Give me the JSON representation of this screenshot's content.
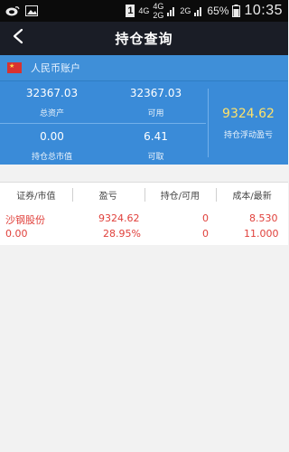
{
  "status_bar": {
    "left_icons": [
      "weibo-icon",
      "gallery-icon"
    ],
    "sim_badge": "1",
    "net1": "4G",
    "net2_top": "4G",
    "net2_bottom": "2G",
    "net3": "2G",
    "battery_percent": "65%",
    "time": "10:35"
  },
  "header": {
    "title": "持仓查询",
    "back_icon": "chevron-left-icon"
  },
  "account": {
    "flag_icon": "cn-flag-icon",
    "name": "人民币账户",
    "total_assets_value": "32367.03",
    "total_assets_label": "总资产",
    "available_value": "32367.03",
    "available_label": "可用",
    "market_value": "0.00",
    "market_value_label": "持仓总市值",
    "withdrawable_value": "6.41",
    "withdrawable_label": "可取",
    "floating_pl_value": "9324.62",
    "floating_pl_label": "持仓浮动盈亏"
  },
  "table": {
    "columns": [
      "证券/市值",
      "盈亏",
      "持仓/可用",
      "成本/最新"
    ],
    "rows": [
      {
        "name": "沙钢股份",
        "market_value": "0.00",
        "pl": "9324.62",
        "pl_pct": "28.95%",
        "position": "0",
        "available": "0",
        "cost": "8.530",
        "latest": "11.000"
      }
    ]
  },
  "colors": {
    "accent_blue": "#3a8bd8",
    "title_bar": "#1a1d26",
    "loss_red": "#e0403b",
    "floating_yellow": "#ffe26a"
  }
}
